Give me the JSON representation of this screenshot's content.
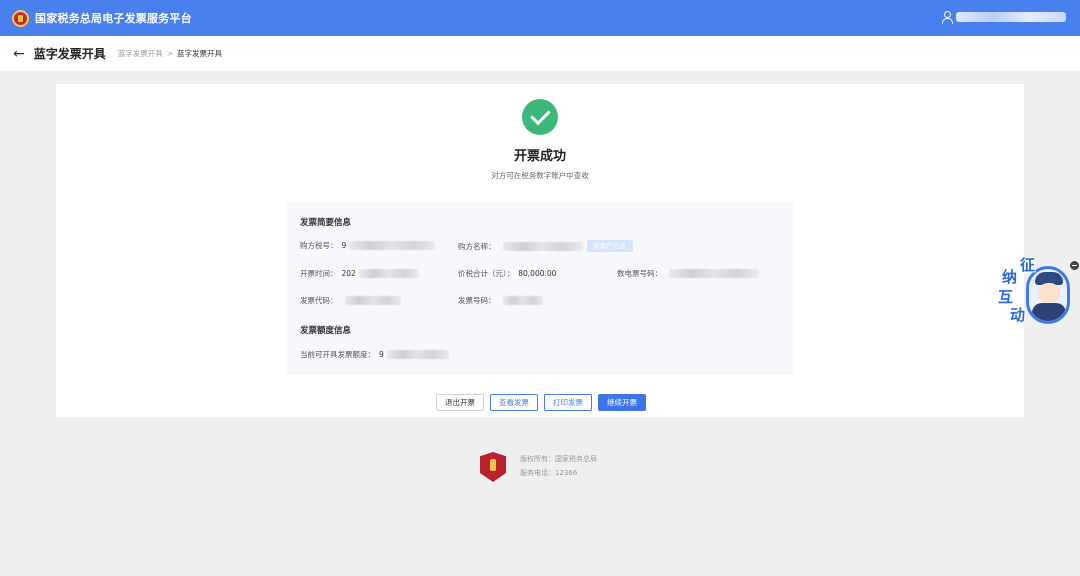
{
  "header": {
    "app_title": "国家税务总局电子发票服务平台",
    "user_name": ""
  },
  "subheader": {
    "page_title": "蓝字发票开具",
    "breadcrumb": [
      "蓝字发票开具",
      "蓝字发票开具"
    ],
    "breadcrumb_sep": ">"
  },
  "result": {
    "title": "开票成功",
    "subtitle": "对方可在税务数字账户中查收"
  },
  "summary": {
    "section_title": "发票简要信息",
    "buyer_tax_no_label": "购方税号：",
    "buyer_tax_no_value": "9",
    "buyer_name_label": "购方名称：",
    "buyer_name_value": "",
    "add_customer_label": "新客户信息",
    "issue_time_label": "开票时间：",
    "issue_time_value": "202",
    "total_label": "价税合计（元）：",
    "total_value": "80,000.00",
    "digital_no_label": "数电票号码：",
    "digital_no_value": "",
    "invoice_code_label": "发票代码：",
    "invoice_code_value": "",
    "invoice_no_label": "发票号码：",
    "invoice_no_value": ""
  },
  "quota": {
    "section_title": "发票额度信息",
    "available_label": "当前可开具发票额度：",
    "available_value": "9"
  },
  "actions": {
    "exit": "退出开票",
    "view": "查看发票",
    "print": "打印发票",
    "continue": "继续开票"
  },
  "footer": {
    "copyright": "版权所有：国家税务总局",
    "hotline": "服务电话：12366",
    "emblem_text": "税务标识"
  },
  "float_widget": {
    "chars": [
      "征",
      "纳",
      "互",
      "动"
    ]
  },
  "colors": {
    "topbar": "#4a7fee",
    "primary": "#3e75ea",
    "success": "#3eb87a"
  }
}
